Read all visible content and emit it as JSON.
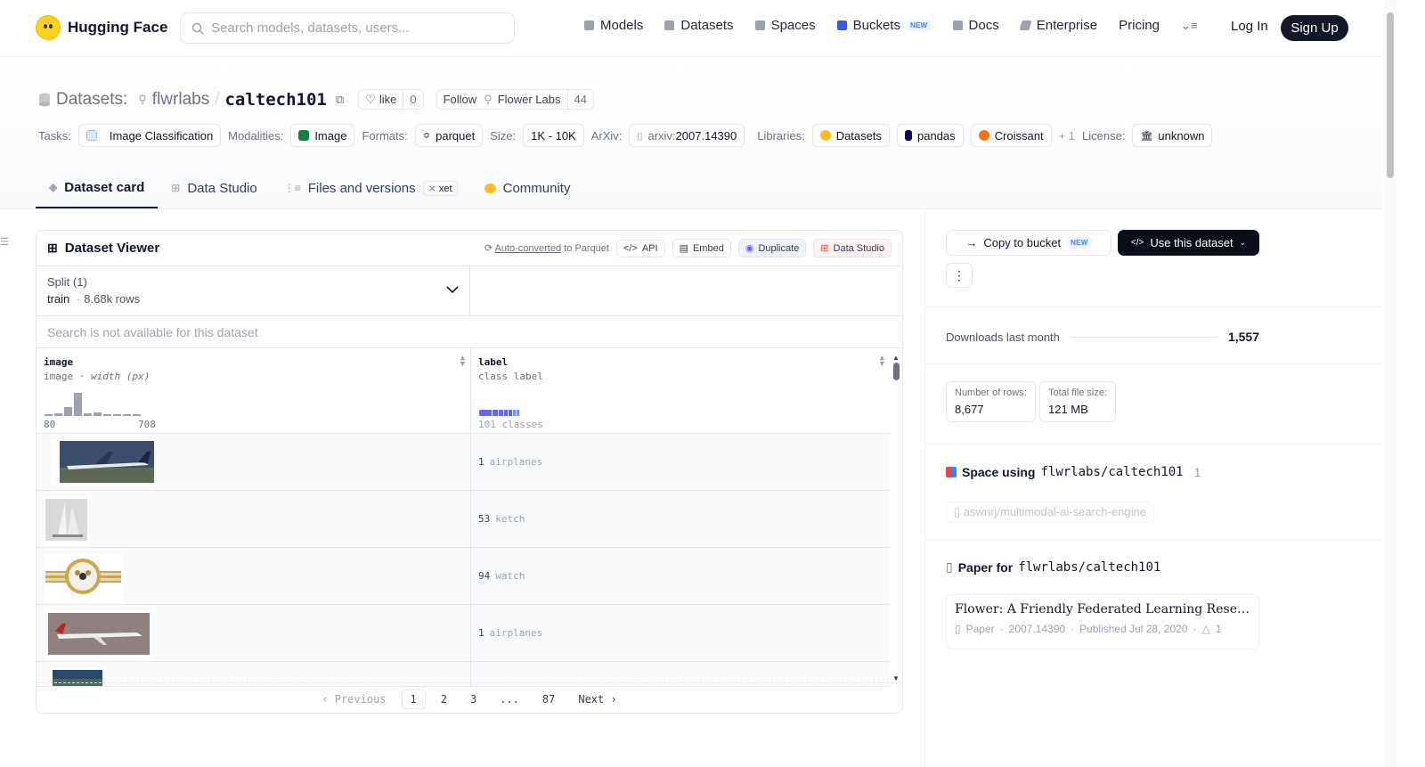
{
  "nav": {
    "brand": "Hugging Face",
    "search_placeholder": "Search models, datasets, users...",
    "links": [
      "Models",
      "Datasets",
      "Spaces",
      "Buckets",
      "Docs",
      "Enterprise",
      "Pricing"
    ],
    "new_badge": "NEW",
    "login": "Log In",
    "signup": "Sign Up"
  },
  "header": {
    "datasets_label": "Datasets:",
    "org": "flwrlabs",
    "separator": "/",
    "name": "caltech101",
    "like_label": "like",
    "like_count": "0",
    "follow_label": "Follow",
    "follow_org": "Flower Labs",
    "follow_count": "44",
    "tags": {
      "tasks_label": "Tasks:",
      "task": "Image Classification",
      "modalities_label": "Modalities:",
      "modality": "Image",
      "formats_label": "Formats:",
      "format": "parquet",
      "size_label": "Size:",
      "size": "1K - 10K",
      "arxiv_label": "ArXiv:",
      "arxiv_prefix": "arxiv:",
      "arxiv": "2007.14390",
      "libraries_label": "Libraries:",
      "lib1": "Datasets",
      "lib2": "pandas",
      "lib3": "Croissant",
      "more": "+ 1",
      "license_label": "License:",
      "license": "unknown"
    }
  },
  "tabs": [
    "Dataset card",
    "Data Studio",
    "Files and versions",
    "Community"
  ],
  "xet_badge": "xet",
  "viewer": {
    "title": "Dataset Viewer",
    "auto_converted": "Auto-converted",
    "to_parquet": "to Parquet",
    "api": "API",
    "embed": "Embed",
    "duplicate": "Duplicate",
    "data_studio": "Data Studio",
    "split_label": "Split (1)",
    "split_value": "train",
    "split_rows": "8.68k rows",
    "search_na": "Search is not available for this dataset",
    "col1_name": "image",
    "col1_type": "image",
    "col1_sub": "width (px)",
    "col1_min": "80",
    "col1_max": "708",
    "col1_hist": [
      0.05,
      0.12,
      0.4,
      1.0,
      0.12,
      0.15,
      0.07,
      0.05,
      0.05,
      0.05
    ],
    "col2_name": "label",
    "col2_type": "class label",
    "col2_classes": "101 classes",
    "rows": [
      {
        "id": "1",
        "label": "airplanes"
      },
      {
        "id": "53",
        "label": "ketch"
      },
      {
        "id": "94",
        "label": "watch"
      },
      {
        "id": "1",
        "label": "airplanes"
      }
    ],
    "pager": {
      "prev": "Previous",
      "pages": [
        "1",
        "2",
        "3",
        "...",
        "87"
      ],
      "next": "Next"
    }
  },
  "sidebar": {
    "copy_bucket": "Copy to bucket",
    "new_badge": "NEW",
    "use_dataset": "Use this dataset",
    "downloads_label": "Downloads last month",
    "downloads": "1,557",
    "rows_label": "Number of rows:",
    "rows_value": "8,677",
    "size_label": "Total file size:",
    "size_value": "121 MB",
    "space_prefix": "Space using",
    "space_repo": "flwrlabs/caltech101",
    "space_count": "1",
    "space_item": "aswnrj/multimodal-ai-search-engine",
    "paper_prefix": "Paper for",
    "paper_repo": "flwrlabs/caltech101",
    "paper_title": "Flower: A Friendly Federated Learning Research Framework",
    "paper_kind": "Paper",
    "paper_id": "2007.14390",
    "paper_published": "Published Jul 28, 2020",
    "paper_upvotes": "1"
  }
}
